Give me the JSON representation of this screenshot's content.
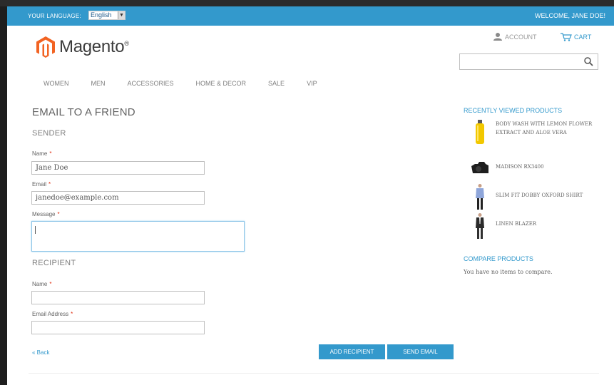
{
  "header": {
    "language_label": "YOUR LANGUAGE:",
    "language_value": "English",
    "welcome": "WELCOME, JANE DOE!",
    "brand": "Magento",
    "brand_mark": "®",
    "account_label": "ACCOUNT",
    "cart_label": "CART",
    "search_value": "",
    "accent_color": "#3399cc",
    "logo_color": "#f26322"
  },
  "nav": {
    "items": [
      {
        "label": "WOMEN"
      },
      {
        "label": "MEN"
      },
      {
        "label": "ACCESSORIES"
      },
      {
        "label": "HOME & DECOR"
      },
      {
        "label": "SALE"
      },
      {
        "label": "VIP"
      }
    ]
  },
  "form": {
    "page_title": "EMAIL TO A FRIEND",
    "sender_title": "SENDER",
    "sender_name_label": "Name",
    "sender_name_value": "Jane Doe",
    "sender_email_label": "Email",
    "sender_email_value": "janedoe@example.com",
    "message_label": "Message",
    "message_value": "",
    "recipient_title": "RECIPIENT",
    "recipient_name_label": "Name",
    "recipient_name_value": "",
    "recipient_email_label": "Email Address",
    "recipient_email_value": "",
    "required_mark": "*",
    "back_link": "« Back",
    "add_recipient_button": "ADD RECIPIENT",
    "send_email_button": "SEND EMAIL"
  },
  "sidebar": {
    "recently_viewed_title": "RECENTLY VIEWED PRODUCTS",
    "recently_viewed": [
      {
        "name": "BODY WASH WITH LEMON FLOWER EXTRACT AND ALOE VERA",
        "icon": "yellow-bottle-icon"
      },
      {
        "name": "MADISON RX3400",
        "icon": "camera-icon"
      },
      {
        "name": "SLIM FIT DOBBY OXFORD SHIRT",
        "icon": "shirt-model-icon"
      },
      {
        "name": "LINEN BLAZER",
        "icon": "blazer-model-icon"
      }
    ],
    "compare_title": "COMPARE PRODUCTS",
    "compare_text": "You have no items to compare."
  }
}
